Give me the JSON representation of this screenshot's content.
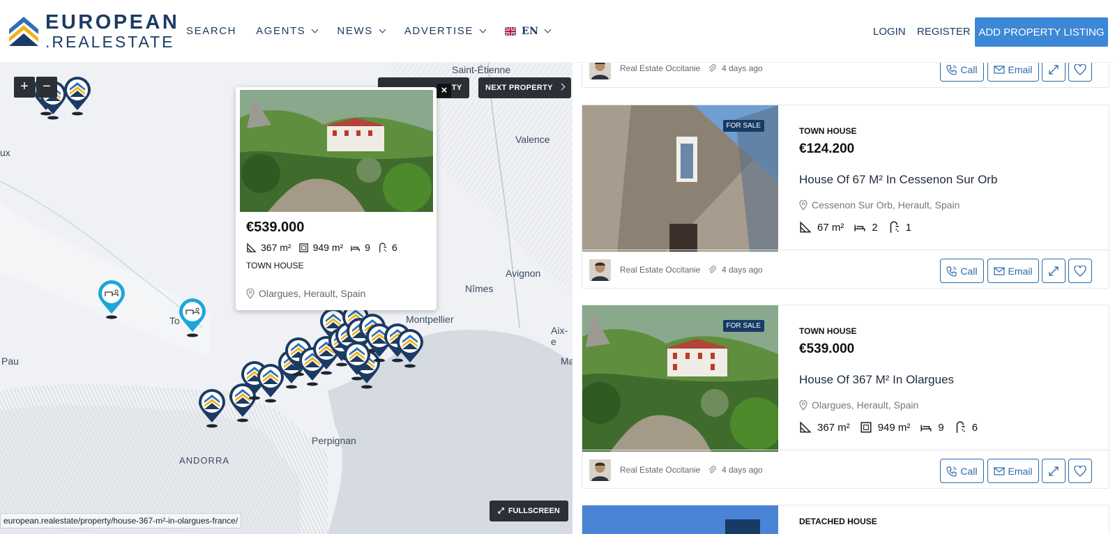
{
  "header": {
    "logo_line1": "EUROPEAN",
    "logo_line2": ".REALESTATE",
    "nav": {
      "search": "SEARCH",
      "agents": "AGENTS",
      "news": "NEWS",
      "advertise": "ADVERTISE",
      "lang": "EN"
    },
    "login": "LOGIN",
    "register": "REGISTER",
    "add_listing": "ADD PROPERTY LISTING"
  },
  "map": {
    "zoom_in": "+",
    "zoom_out": "−",
    "prev_property": "ERTY",
    "next_property": "NEXT PROPERTY",
    "fullscreen": "FULLSCREEN",
    "labels": {
      "saint_etienne": "Saint-Étienne",
      "valence": "Valence",
      "ux": "ux",
      "avignon": "Avignon",
      "nimes": "Nîmes",
      "montpellier": "Montpellier",
      "aix": "Aix-e",
      "ma": "Ma",
      "to": "To",
      "pau": "Pau",
      "perpignan": "Perpignan",
      "andorra": "ANDORRA"
    },
    "popup": {
      "price": "€539.000",
      "area": "367 m²",
      "plot": "949 m²",
      "beds": "9",
      "baths": "6",
      "type": "TOWN HOUSE",
      "location": "Olargues, Herault, Spain"
    },
    "status_url": "european.realestate/property/house-367-m²-in-olargues-france/"
  },
  "listings": [
    {
      "agent": "Real Estate Occitanie",
      "ago": "4 days ago"
    },
    {
      "badge": "FOR SALE",
      "type": "TOWN HOUSE",
      "price": "€124.200",
      "title": "House Of 67 M² In Cessenon Sur Orb",
      "location": "Cessenon Sur Orb, Herault, Spain",
      "area": "67 m²",
      "beds": "2",
      "baths": "1",
      "agent": "Real Estate Occitanie",
      "ago": "4 days ago"
    },
    {
      "badge": "FOR SALE",
      "type": "TOWN HOUSE",
      "price": "€539.000",
      "title": "House Of 367 M² In Olargues",
      "location": "Olargues, Herault, Spain",
      "area": "367 m²",
      "plot": "949 m²",
      "beds": "9",
      "baths": "6",
      "agent": "Real Estate Occitanie",
      "ago": "4 days ago"
    },
    {
      "type": "DETACHED HOUSE"
    }
  ],
  "actions": {
    "call": "Call",
    "email": "Email"
  },
  "colors": {
    "brand_navy": "#1c3b63",
    "accent_blue": "#3d87d7",
    "logo_yellow": "#f3b21b",
    "logo_blue": "#2f6fb8",
    "pin_cyan": "#1ba7d9"
  }
}
